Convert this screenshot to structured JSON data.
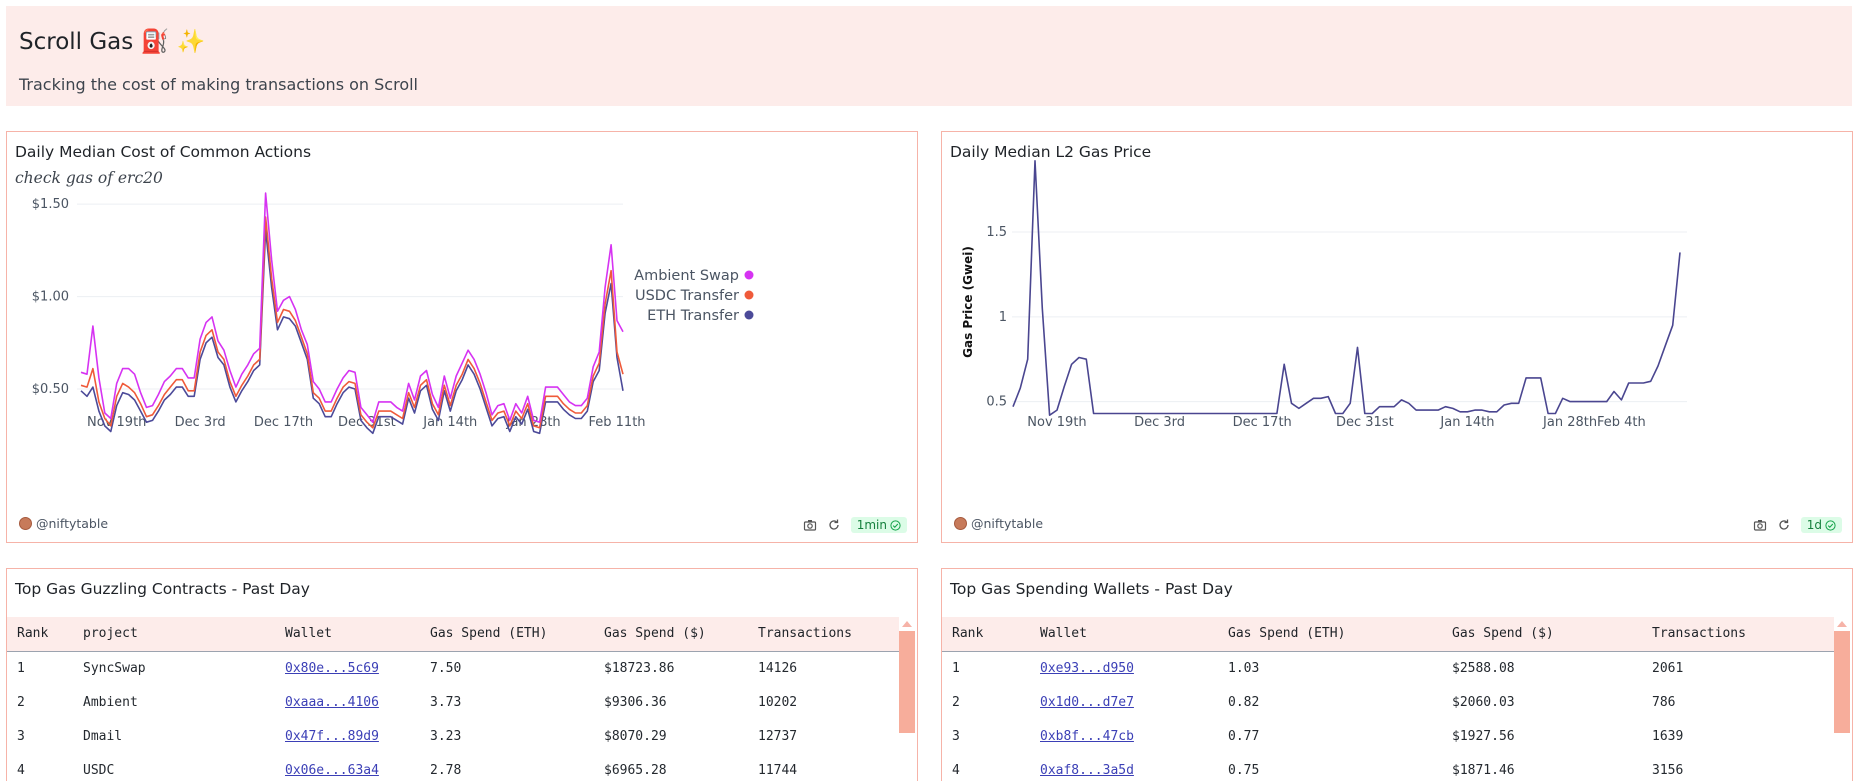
{
  "header": {
    "title": "Scroll Gas",
    "emoji": "⛽ ✨",
    "subtitle": "Tracking the cost of making transactions on Scroll"
  },
  "cost_panel": {
    "title": "Daily Median Cost of Common Actions",
    "subtitle": "check gas of erc20",
    "credit": "@niftytable",
    "refresh": "1min"
  },
  "l2_panel": {
    "title": "Daily Median L2 Gas Price",
    "credit": "@niftytable",
    "refresh": "1d"
  },
  "contracts_panel": {
    "title": "Top Gas Guzzling Contracts - Past Day",
    "columns": [
      "Rank",
      "project",
      "Wallet",
      "Gas Spend (ETH)",
      "Gas Spend ($)",
      "Transactions"
    ],
    "rows": [
      [
        "1",
        "SyncSwap",
        "0x80e...5c69",
        "7.50",
        "$18723.86",
        "14126"
      ],
      [
        "2",
        "Ambient",
        "0xaaa...4106",
        "3.73",
        "$9306.36",
        "10202"
      ],
      [
        "3",
        "Dmail",
        "0x47f...89d9",
        "3.23",
        "$8070.29",
        "12737"
      ],
      [
        "4",
        "USDC",
        "0x06e...63a4",
        "2.78",
        "$6965.28",
        "11744"
      ]
    ]
  },
  "wallets_panel": {
    "title": "Top Gas Spending Wallets - Past Day",
    "columns": [
      "Rank",
      "Wallet",
      "Gas Spend (ETH)",
      "Gas Spend ($)",
      "Transactions"
    ],
    "rows": [
      [
        "1",
        "0xe93...d950",
        "1.03",
        "$2588.08",
        "2061"
      ],
      [
        "2",
        "0x1d0...d7e7",
        "0.82",
        "$2060.03",
        "786"
      ],
      [
        "3",
        "0xb8f...47cb",
        "0.77",
        "$1927.56",
        "1639"
      ],
      [
        "4",
        "0xaf8...3a5d",
        "0.75",
        "$1871.46",
        "3156"
      ]
    ]
  },
  "colors": {
    "ambient": "#d633f2",
    "usdc": "#ef5a3a",
    "eth": "#4c4a99",
    "l2": "#4a4690"
  },
  "chart_data": [
    {
      "type": "line",
      "title": "Daily Median Cost of Common Actions",
      "subtitle": "check gas of erc20",
      "y_ticks": [
        "$0.50",
        "$1.00",
        "$1.50"
      ],
      "ylim": [
        0.24,
        1.62
      ],
      "x_ticks": [
        "Nov 19th",
        "Dec 3rd",
        "Dec 17th",
        "Dec 31st",
        "Jan 14th",
        "Jan 28th",
        "Feb 11th"
      ],
      "x_tick_index": [
        6,
        20,
        34,
        48,
        62,
        76,
        90
      ],
      "legend_position": "right",
      "series": [
        {
          "name": "Ambient Swap",
          "values": [
            0.59,
            0.58,
            0.84,
            0.56,
            0.37,
            0.34,
            0.53,
            0.61,
            0.61,
            0.58,
            0.48,
            0.4,
            0.41,
            0.47,
            0.54,
            0.57,
            0.61,
            0.61,
            0.56,
            0.56,
            0.77,
            0.86,
            0.89,
            0.76,
            0.71,
            0.6,
            0.51,
            0.58,
            0.63,
            0.69,
            0.72,
            1.56,
            1.2,
            0.92,
            0.98,
            1.0,
            0.93,
            0.82,
            0.74,
            0.54,
            0.5,
            0.43,
            0.43,
            0.5,
            0.56,
            0.6,
            0.59,
            0.4,
            0.36,
            0.32,
            0.43,
            0.43,
            0.43,
            0.4,
            0.38,
            0.53,
            0.44,
            0.57,
            0.6,
            0.47,
            0.4,
            0.57,
            0.45,
            0.57,
            0.64,
            0.71,
            0.66,
            0.58,
            0.48,
            0.36,
            0.41,
            0.42,
            0.33,
            0.42,
            0.37,
            0.46,
            0.33,
            0.32,
            0.51,
            0.51,
            0.51,
            0.47,
            0.43,
            0.41,
            0.41,
            0.45,
            0.62,
            0.7,
            1.05,
            1.28,
            0.87,
            0.81
          ]
        },
        {
          "name": "USDC Transfer",
          "values": [
            0.52,
            0.51,
            0.61,
            0.43,
            0.34,
            0.3,
            0.46,
            0.53,
            0.51,
            0.48,
            0.42,
            0.35,
            0.36,
            0.41,
            0.47,
            0.51,
            0.55,
            0.55,
            0.49,
            0.49,
            0.7,
            0.79,
            0.82,
            0.7,
            0.66,
            0.54,
            0.46,
            0.52,
            0.57,
            0.63,
            0.66,
            1.43,
            1.1,
            0.86,
            0.93,
            0.92,
            0.87,
            0.78,
            0.69,
            0.48,
            0.45,
            0.38,
            0.38,
            0.45,
            0.51,
            0.54,
            0.53,
            0.36,
            0.32,
            0.29,
            0.38,
            0.38,
            0.38,
            0.36,
            0.34,
            0.48,
            0.4,
            0.52,
            0.55,
            0.42,
            0.36,
            0.52,
            0.41,
            0.52,
            0.58,
            0.66,
            0.61,
            0.53,
            0.43,
            0.33,
            0.37,
            0.38,
            0.3,
            0.38,
            0.34,
            0.42,
            0.3,
            0.29,
            0.46,
            0.46,
            0.46,
            0.42,
            0.39,
            0.37,
            0.37,
            0.41,
            0.57,
            0.64,
            0.96,
            1.14,
            0.7,
            0.58
          ]
        },
        {
          "name": "ETH Transfer",
          "values": [
            0.49,
            0.46,
            0.51,
            0.38,
            0.3,
            0.27,
            0.41,
            0.48,
            0.47,
            0.44,
            0.38,
            0.32,
            0.33,
            0.38,
            0.44,
            0.47,
            0.51,
            0.51,
            0.46,
            0.46,
            0.66,
            0.75,
            0.78,
            0.67,
            0.63,
            0.51,
            0.43,
            0.49,
            0.54,
            0.6,
            0.63,
            1.36,
            1.05,
            0.82,
            0.89,
            0.88,
            0.84,
            0.75,
            0.66,
            0.45,
            0.42,
            0.35,
            0.35,
            0.42,
            0.48,
            0.51,
            0.5,
            0.33,
            0.29,
            0.26,
            0.35,
            0.35,
            0.35,
            0.33,
            0.31,
            0.45,
            0.37,
            0.49,
            0.52,
            0.39,
            0.33,
            0.49,
            0.38,
            0.49,
            0.55,
            0.63,
            0.58,
            0.5,
            0.4,
            0.3,
            0.34,
            0.35,
            0.27,
            0.35,
            0.31,
            0.39,
            0.27,
            0.26,
            0.43,
            0.43,
            0.43,
            0.39,
            0.36,
            0.34,
            0.34,
            0.38,
            0.54,
            0.6,
            0.91,
            1.07,
            0.67,
            0.49
          ]
        }
      ]
    },
    {
      "type": "line",
      "title": "Daily Median L2 Gas Price",
      "ylabel": "Gas Price (Gwei)",
      "y_ticks": [
        "0.5",
        "1",
        "1.5"
      ],
      "y_tick_values": [
        0.5,
        1,
        1.5
      ],
      "ylim": [
        0.38,
        1.96
      ],
      "x_ticks": [
        "Nov 19th",
        "Dec 3rd",
        "Dec 17th",
        "Dec 31st",
        "Jan 14th",
        "Jan 28th",
        "Feb 4th"
      ],
      "x_tick_index": [
        6,
        20,
        34,
        48,
        62,
        76,
        83
      ],
      "series": [
        {
          "name": "L2 Gas Price",
          "values": [
            0.47,
            0.58,
            0.75,
            1.92,
            1.05,
            0.42,
            0.45,
            0.59,
            0.72,
            0.76,
            0.75,
            0.43,
            0.43,
            0.43,
            0.43,
            0.43,
            0.43,
            0.43,
            0.43,
            0.43,
            0.43,
            0.43,
            0.43,
            0.43,
            0.43,
            0.43,
            0.43,
            0.43,
            0.43,
            0.43,
            0.43,
            0.43,
            0.43,
            0.43,
            0.43,
            0.43,
            0.43,
            0.72,
            0.49,
            0.46,
            0.49,
            0.52,
            0.52,
            0.53,
            0.43,
            0.43,
            0.49,
            0.82,
            0.43,
            0.43,
            0.47,
            0.47,
            0.47,
            0.51,
            0.49,
            0.45,
            0.45,
            0.45,
            0.45,
            0.47,
            0.46,
            0.44,
            0.44,
            0.45,
            0.45,
            0.44,
            0.44,
            0.48,
            0.49,
            0.49,
            0.64,
            0.64,
            0.64,
            0.43,
            0.43,
            0.52,
            0.5,
            0.5,
            0.5,
            0.5,
            0.5,
            0.5,
            0.56,
            0.51,
            0.61,
            0.61,
            0.61,
            0.62,
            0.71,
            0.83,
            0.95,
            1.38
          ]
        }
      ]
    }
  ]
}
